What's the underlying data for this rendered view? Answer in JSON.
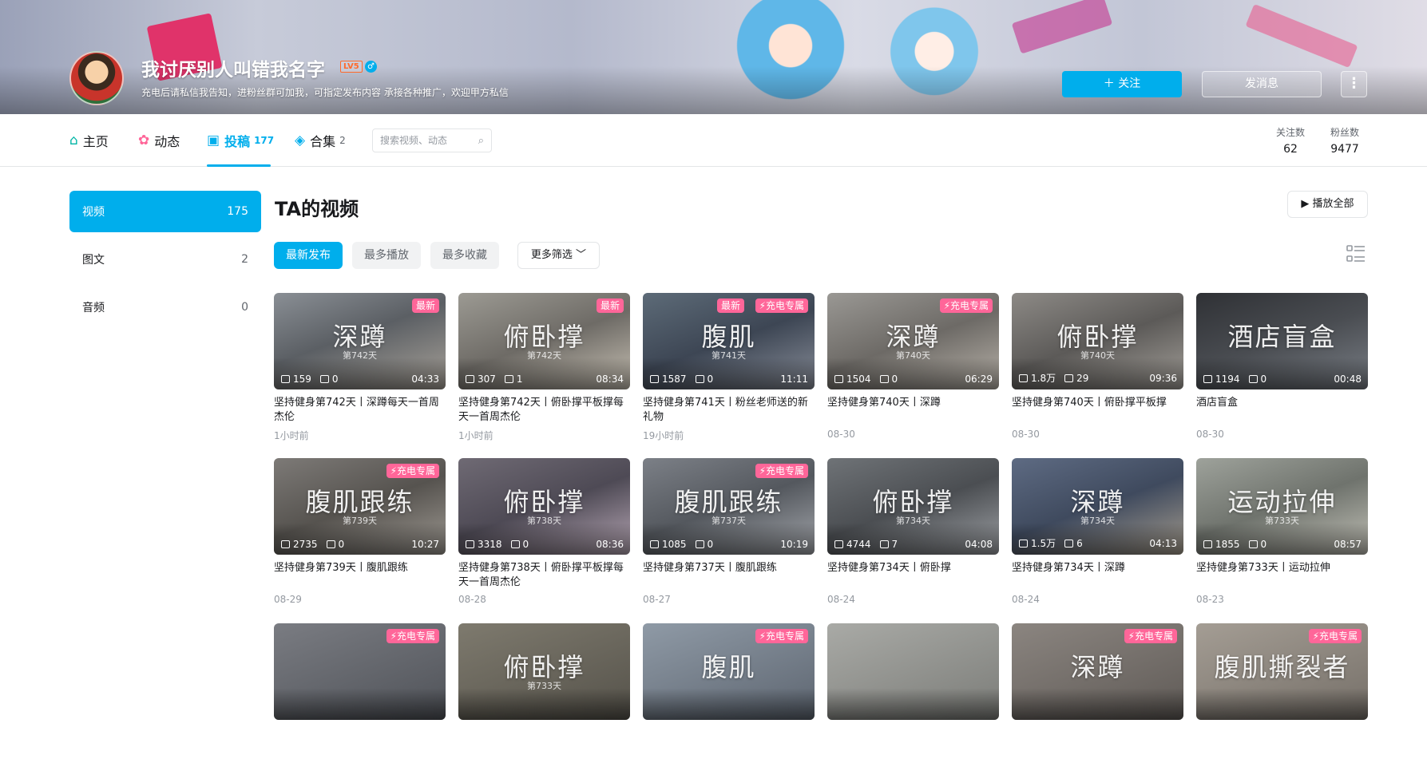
{
  "header": {
    "username": "我讨厌别人叫错我名字",
    "level": "LV5",
    "gender_icon": "♂",
    "sign": "充电后请私信我告知，进粉丝群可加我，可指定发布内容 承接各种推广，欢迎甲方私信",
    "follow_label": "＋ 关注",
    "message_label": "发消息",
    "more_label": "⋮"
  },
  "nav": {
    "items": [
      {
        "label": "主页",
        "icon": "home-icon",
        "count": ""
      },
      {
        "label": "动态",
        "icon": "dynamic-icon",
        "count": ""
      },
      {
        "label": "投稿",
        "icon": "upload-icon",
        "count": "177"
      },
      {
        "label": "合集",
        "icon": "collection-icon",
        "count": "2"
      }
    ],
    "search_placeholder": "搜索视频、动态",
    "following_label": "关注数",
    "following_value": "62",
    "followers_label": "粉丝数",
    "followers_value": "9477"
  },
  "side_menu": [
    {
      "label": "视频",
      "count": "175"
    },
    {
      "label": "图文",
      "count": "2"
    },
    {
      "label": "音频",
      "count": "0"
    }
  ],
  "main": {
    "title": "TA的视频",
    "play_all": "▶ 播放全部",
    "filters": [
      "最新发布",
      "最多播放",
      "最多收藏"
    ],
    "more_filter": "更多筛选 ﹀"
  },
  "colors": {
    "accent": "#00aeec",
    "badge": "#ff6699"
  },
  "videos": [
    {
      "caption": "深蹲",
      "sub": "第742天",
      "badges": [
        "最新"
      ],
      "plays": "159",
      "comments": "0",
      "duration": "04:33",
      "title": "坚持健身第742天丨深蹲每天一首周杰伦",
      "date": "1小时前"
    },
    {
      "caption": "俯卧撑",
      "sub": "第742天",
      "badges": [
        "最新"
      ],
      "plays": "307",
      "comments": "1",
      "duration": "08:34",
      "title": "坚持健身第742天丨俯卧撑平板撑每天一首周杰伦",
      "date": "1小时前"
    },
    {
      "caption": "腹肌",
      "sub": "第741天",
      "badges": [
        "最新",
        "⚡充电专属"
      ],
      "plays": "1587",
      "comments": "0",
      "duration": "11:11",
      "title": "坚持健身第741天丨粉丝老师送的新礼物",
      "date": "19小时前"
    },
    {
      "caption": "深蹲",
      "sub": "第740天",
      "badges": [
        "⚡充电专属"
      ],
      "plays": "1504",
      "comments": "0",
      "duration": "06:29",
      "title": "坚持健身第740天丨深蹲",
      "date": "08-30"
    },
    {
      "caption": "俯卧撑",
      "sub": "第740天",
      "badges": [],
      "plays": "1.8万",
      "comments": "29",
      "duration": "09:36",
      "title": "坚持健身第740天丨俯卧撑平板撑",
      "date": "08-30"
    },
    {
      "caption": "酒店盲盒",
      "sub": "",
      "badges": [],
      "plays": "1194",
      "comments": "0",
      "duration": "00:48",
      "title": "酒店盲盒",
      "date": "08-30"
    },
    {
      "caption": "腹肌跟练",
      "sub": "第739天",
      "badges": [
        "⚡充电专属"
      ],
      "plays": "2735",
      "comments": "0",
      "duration": "10:27",
      "title": "坚持健身第739天丨腹肌跟练",
      "date": "08-29"
    },
    {
      "caption": "俯卧撑",
      "sub": "第738天",
      "badges": [],
      "plays": "3318",
      "comments": "0",
      "duration": "08:36",
      "title": "坚持健身第738天丨俯卧撑平板撑每天一首周杰伦",
      "date": "08-28"
    },
    {
      "caption": "腹肌跟练",
      "sub": "第737天",
      "badges": [
        "⚡充电专属"
      ],
      "plays": "1085",
      "comments": "0",
      "duration": "10:19",
      "title": "坚持健身第737天丨腹肌跟练",
      "date": "08-27"
    },
    {
      "caption": "俯卧撑",
      "sub": "第734天",
      "badges": [],
      "plays": "4744",
      "comments": "7",
      "duration": "04:08",
      "title": "坚持健身第734天丨俯卧撑",
      "date": "08-24"
    },
    {
      "caption": "深蹲",
      "sub": "第734天",
      "badges": [],
      "plays": "1.5万",
      "comments": "6",
      "duration": "04:13",
      "title": "坚持健身第734天丨深蹲",
      "date": "08-24"
    },
    {
      "caption": "运动拉伸",
      "sub": "第733天",
      "badges": [],
      "plays": "1855",
      "comments": "0",
      "duration": "08:57",
      "title": "坚持健身第733天丨运动拉伸",
      "date": "08-23"
    },
    {
      "caption": "",
      "sub": "",
      "badges": [
        "⚡充电专属"
      ],
      "plays": "",
      "comments": "",
      "duration": "",
      "title": "",
      "date": ""
    },
    {
      "caption": "俯卧撑",
      "sub": "第733天",
      "badges": [],
      "plays": "",
      "comments": "",
      "duration": "",
      "title": "",
      "date": ""
    },
    {
      "caption": "腹肌",
      "sub": "",
      "badges": [
        "⚡充电专属"
      ],
      "plays": "",
      "comments": "",
      "duration": "",
      "title": "",
      "date": ""
    },
    {
      "caption": "",
      "sub": "",
      "badges": [],
      "plays": "",
      "comments": "",
      "duration": "",
      "title": "",
      "date": ""
    },
    {
      "caption": "深蹲",
      "sub": "",
      "badges": [
        "⚡充电专属"
      ],
      "plays": "",
      "comments": "",
      "duration": "",
      "title": "",
      "date": ""
    },
    {
      "caption": "腹肌撕裂者",
      "sub": "",
      "badges": [
        "⚡充电专属"
      ],
      "plays": "",
      "comments": "",
      "duration": "",
      "title": "",
      "date": ""
    }
  ]
}
